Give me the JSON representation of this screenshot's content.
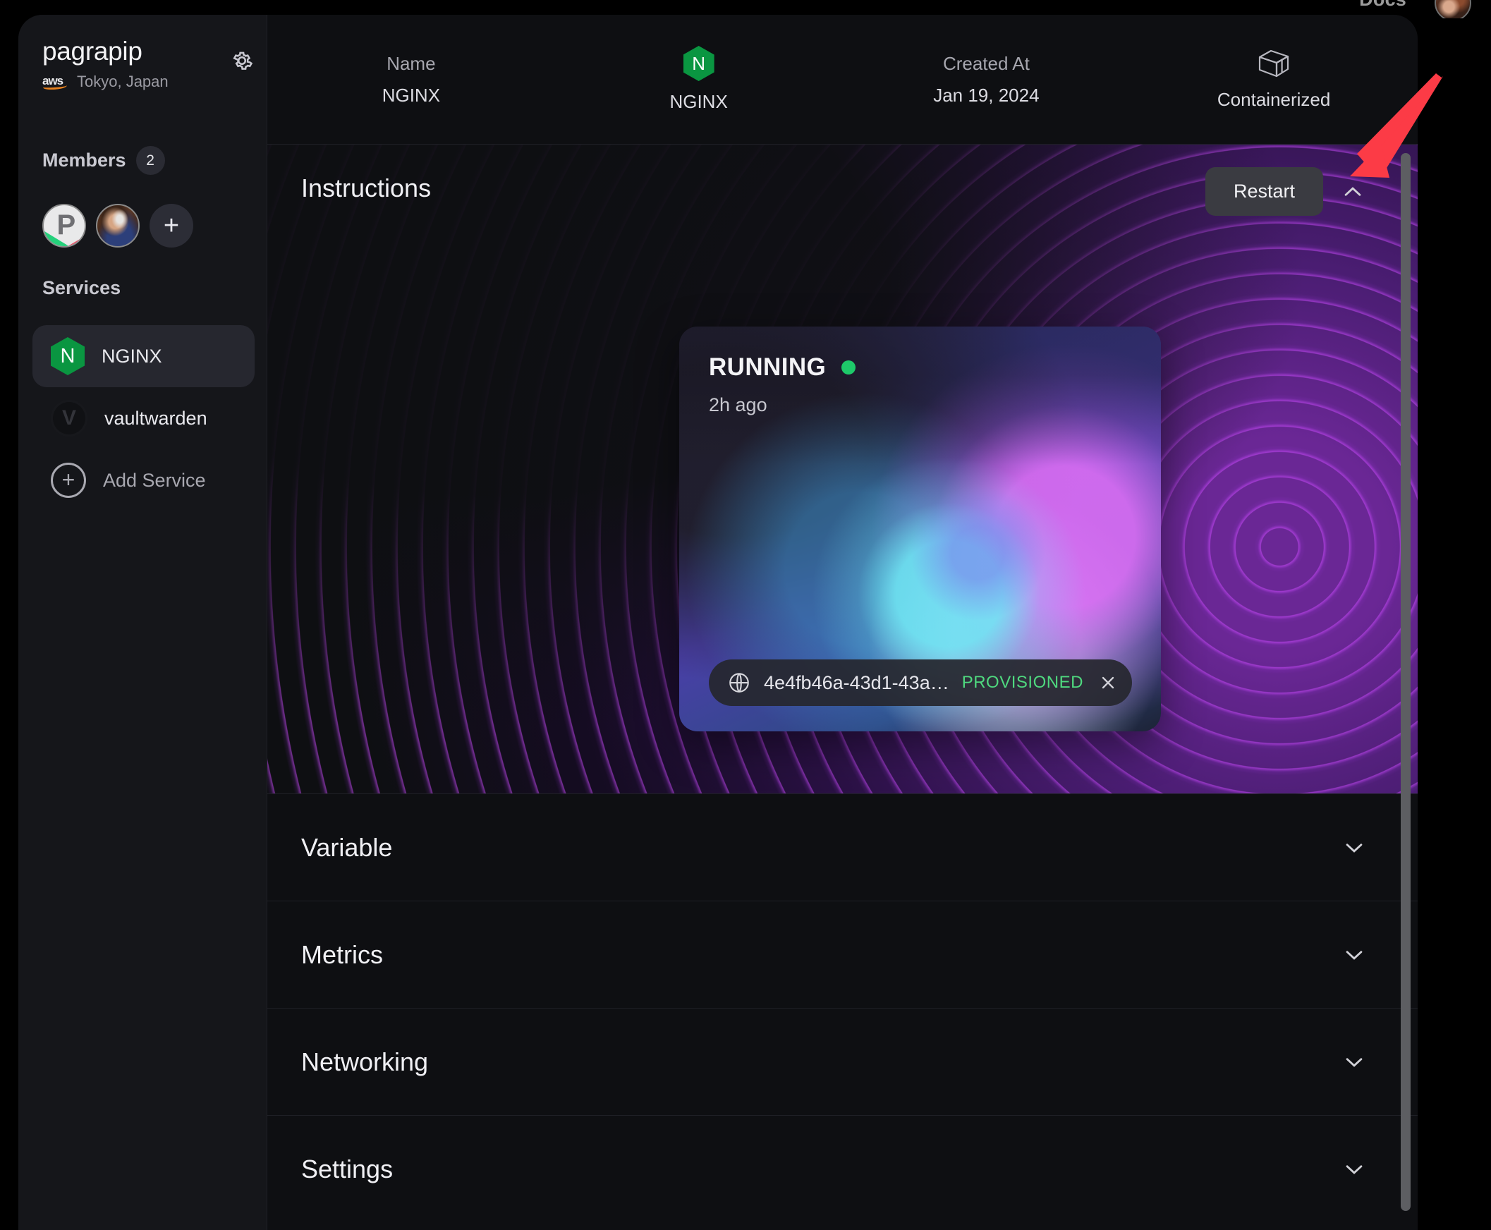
{
  "window": {
    "top_nav": {
      "docs_label": "Docs"
    }
  },
  "sidebar": {
    "org": {
      "name": "pagrapip",
      "provider_icon": "aws-logo",
      "region": "Tokyo, Japan"
    },
    "settings_icon": "gear-icon",
    "members": {
      "label": "Members",
      "count": "2",
      "add_label": "+"
    },
    "services": {
      "label": "Services",
      "items": [
        {
          "label": "NGINX",
          "icon": "nginx-hexagon-icon",
          "active": true
        },
        {
          "label": "vaultwarden",
          "icon": "vaultwarden-shield-icon",
          "active": false
        }
      ],
      "add_service_label": "Add Service",
      "add_service_icon": "plus-circle-icon"
    }
  },
  "topbar": {
    "cells": [
      {
        "caption": "Name",
        "value": "NGINX"
      },
      {
        "caption": "",
        "value": "NGINX",
        "icon": "nginx-hexagon-icon"
      },
      {
        "caption": "Created At",
        "value": "Jan 19, 2024"
      },
      {
        "caption": "",
        "value": "Containerized",
        "icon": "container-box-icon"
      }
    ]
  },
  "instructions": {
    "title": "Instructions",
    "restart_label": "Restart",
    "collapse_icon": "chevron-up-icon",
    "status_card": {
      "status": "RUNNING",
      "status_color": "#1ec96a",
      "timestamp": "2h ago",
      "chip": {
        "icon": "globe-icon",
        "id": "4e4fb46a-43d1-43a…",
        "state": "PROVISIONED",
        "state_color": "#4fd97f",
        "dismiss_icon": "close-icon"
      }
    }
  },
  "accordion": [
    {
      "title": "Variable",
      "icon": "chevron-down-icon"
    },
    {
      "title": "Metrics",
      "icon": "chevron-down-icon"
    },
    {
      "title": "Networking",
      "icon": "chevron-down-icon"
    },
    {
      "title": "Settings",
      "icon": "chevron-down-icon"
    }
  ],
  "annotation": {
    "arrow_color": "#fc3b46",
    "points_at": "Restart"
  }
}
